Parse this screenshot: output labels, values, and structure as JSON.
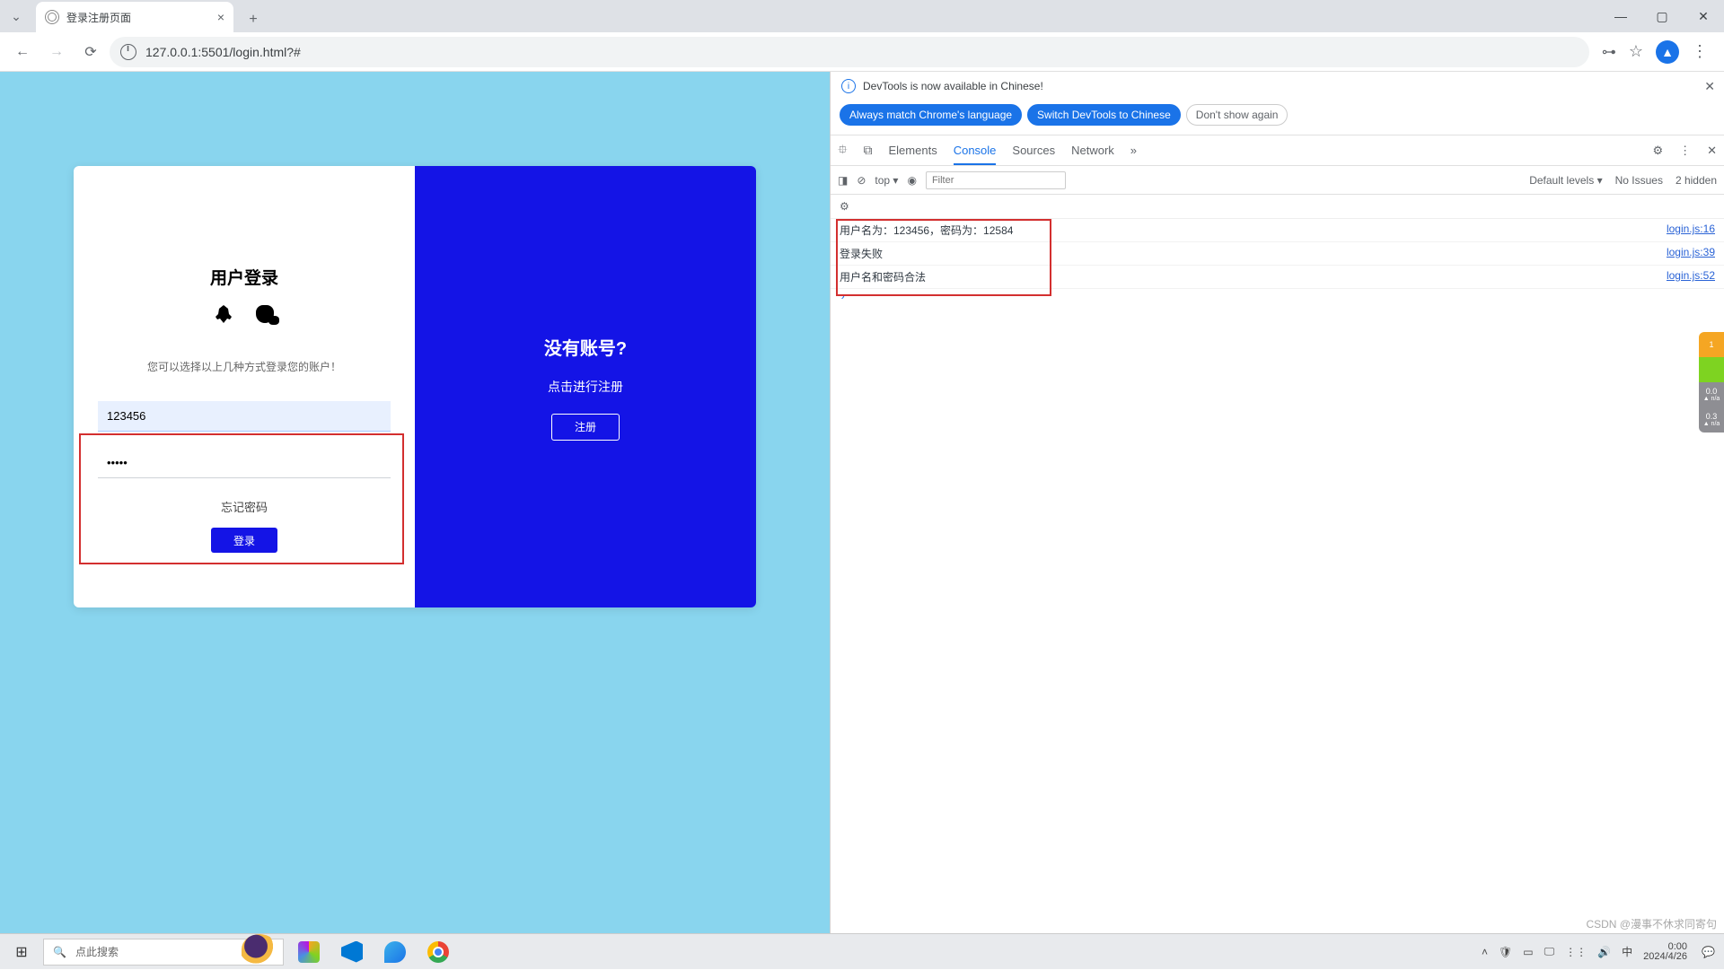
{
  "browser": {
    "tab_title": "登录注册页面",
    "url": "127.0.0.1:5501/login.html?#"
  },
  "login": {
    "title": "用户登录",
    "hint": "您可以选择以上几种方式登录您的账户！",
    "username_value": "123456",
    "password_value": "•••••",
    "forgot": "忘记密码",
    "submit": "登录"
  },
  "register": {
    "title": "没有账号?",
    "subtitle": "点击进行注册",
    "button": "注册"
  },
  "devtools": {
    "banner": "DevTools is now available in Chinese!",
    "pill_match": "Always match Chrome's language",
    "pill_switch": "Switch DevTools to Chinese",
    "pill_dont": "Don't show again",
    "tabs": {
      "elements": "Elements",
      "console": "Console",
      "sources": "Sources",
      "network": "Network"
    },
    "context": "top",
    "filter_placeholder": "Filter",
    "levels": "Default levels",
    "no_issues": "No Issues",
    "hidden": "2 hidden",
    "logs": [
      {
        "msg": "用户名为：123456，密码为：12584",
        "src": "login.js:16"
      },
      {
        "msg": "登录失败",
        "src": "login.js:39"
      },
      {
        "msg": "用户名和密码合法",
        "src": "login.js:52"
      }
    ]
  },
  "side_tags": {
    "t1": "1",
    "t3a": "0.0",
    "t3b": "▲ n/a",
    "t4a": "0.3",
    "t4b": "▲ n/a"
  },
  "taskbar": {
    "search_placeholder": "点此搜索",
    "time": "0:00",
    "date": "2024/4/26"
  },
  "watermark": "CSDN @漫事不休求同寄句"
}
